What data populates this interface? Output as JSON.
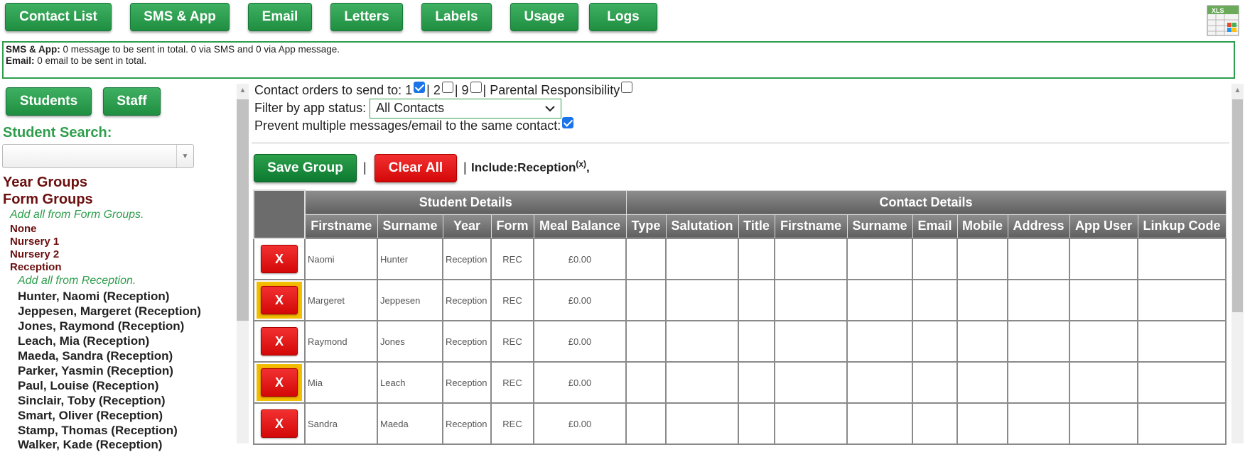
{
  "nav": {
    "buttons": [
      "Contact List",
      "SMS & App",
      "Email",
      "Letters",
      "Labels",
      "Usage",
      "Logs"
    ],
    "export_icon": "excel-xls-icon",
    "export_label": "XLS"
  },
  "summary": {
    "sms_label": "SMS & App:",
    "sms_text": "0 message to be sent in total. 0 via SMS and 0 via App message.",
    "email_label": "Email:",
    "email_text": "0 email to be sent in total."
  },
  "sidebar": {
    "students_btn": "Students",
    "staff_btn": "Staff",
    "search_title": "Student Search:",
    "search_value": "",
    "year_groups": "Year Groups",
    "form_groups": "Form Groups",
    "add_all_form": "Add all from Form Groups.",
    "groups": [
      "None",
      "Nursery 1",
      "Nursery 2",
      "Reception"
    ],
    "add_all_reception": "Add all from Reception.",
    "students": [
      "Hunter, Naomi (Reception)",
      "Jeppesen, Margeret (Reception)",
      "Jones, Raymond (Reception)",
      "Leach, Mia (Reception)",
      "Maeda, Sandra (Reception)",
      "Parker, Yasmin (Reception)",
      "Paul, Louise (Reception)",
      "Sinclair, Toby (Reception)",
      "Smart, Oliver (Reception)",
      "Stamp, Thomas (Reception)",
      "Walker, Kade (Reception)"
    ]
  },
  "options": {
    "contact_orders_label": "Contact orders to send to: 1",
    "sep1": "| 2",
    "sep2": "| 9",
    "parental_label": "| Parental Responsibility",
    "order1_checked": true,
    "order2_checked": false,
    "order9_checked": false,
    "parental_checked": false,
    "filter_label": "Filter by app status:",
    "filter_value": "All Contacts",
    "prevent_label": "Prevent multiple messages/email to the same contact:",
    "prevent_checked": true
  },
  "actions": {
    "save_group": "Save Group",
    "clear_all": "Clear All",
    "pipe": "|",
    "include_label": "Include:Reception",
    "include_remove": "(x)",
    "include_suffix": ","
  },
  "table": {
    "group_student": "Student Details",
    "group_contact": "Contact Details",
    "columns": [
      "Firstname",
      "Surname",
      "Year",
      "Form",
      "Meal Balance",
      "Type",
      "Salutation",
      "Title",
      "Firstname",
      "Surname",
      "Email",
      "Mobile",
      "Address",
      "App User",
      "Linkup Code"
    ],
    "remove_label": "X",
    "rows": [
      {
        "firstname": "Naomi",
        "surname": "Hunter",
        "year": "Reception",
        "form": "REC",
        "meal": "£0.00",
        "highlight": false
      },
      {
        "firstname": "Margeret",
        "surname": "Jeppesen",
        "year": "Reception",
        "form": "REC",
        "meal": "£0.00",
        "highlight": true
      },
      {
        "firstname": "Raymond",
        "surname": "Jones",
        "year": "Reception",
        "form": "REC",
        "meal": "£0.00",
        "highlight": false
      },
      {
        "firstname": "Mia",
        "surname": "Leach",
        "year": "Reception",
        "form": "REC",
        "meal": "£0.00",
        "highlight": true
      },
      {
        "firstname": "Sandra",
        "surname": "Maeda",
        "year": "Reception",
        "form": "REC",
        "meal": "£0.00",
        "highlight": false
      }
    ]
  },
  "colors": {
    "primary_green": "#2e9e4c",
    "danger_red": "#e01818",
    "highlight_yellow": "#f7b700",
    "group_title": "#6b0f0f"
  }
}
